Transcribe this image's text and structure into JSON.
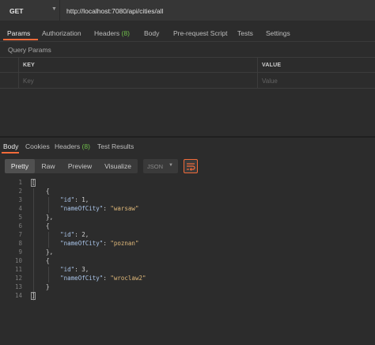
{
  "request": {
    "method": "GET",
    "url": "http://localhost:7080/api/cities/all"
  },
  "request_tabs": [
    {
      "label": "Params",
      "count": ""
    },
    {
      "label": "Authorization",
      "count": ""
    },
    {
      "label": "Headers",
      "count": "(8)"
    },
    {
      "label": "Body",
      "count": ""
    },
    {
      "label": "Pre-request Script",
      "count": ""
    },
    {
      "label": "Tests",
      "count": ""
    },
    {
      "label": "Settings",
      "count": ""
    }
  ],
  "query_params": {
    "title": "Query Params",
    "key_header": "KEY",
    "value_header": "VALUE",
    "key_placeholder": "Key",
    "value_placeholder": "Value"
  },
  "response_tabs": [
    {
      "label": "Body",
      "count": ""
    },
    {
      "label": "Cookies",
      "count": ""
    },
    {
      "label": "Headers",
      "count": "(8)"
    },
    {
      "label": "Test Results",
      "count": ""
    }
  ],
  "view_modes": [
    "Pretty",
    "Raw",
    "Preview",
    "Visualize"
  ],
  "format": "JSON",
  "colors": {
    "accent": "#f26b3a",
    "count": "#6fbf4a",
    "string": "#e0b97a",
    "key": "#a9c4e8"
  },
  "response_body": [
    {
      "n": "1",
      "t": "["
    },
    {
      "n": "2",
      "t": "    {"
    },
    {
      "n": "3",
      "key": "\"id\"",
      "val": "1",
      "vtype": "num",
      "indent": "        "
    },
    {
      "n": "4",
      "key": "\"nameOfCity\"",
      "val": "\"warsaw\"",
      "vtype": "str",
      "indent": "        "
    },
    {
      "n": "5",
      "t": "    },"
    },
    {
      "n": "6",
      "t": "    {"
    },
    {
      "n": "7",
      "key": "\"id\"",
      "val": "2",
      "vtype": "num",
      "indent": "        "
    },
    {
      "n": "8",
      "key": "\"nameOfCity\"",
      "val": "\"poznan\"",
      "vtype": "str",
      "indent": "        "
    },
    {
      "n": "9",
      "t": "    },"
    },
    {
      "n": "10",
      "t": "    {"
    },
    {
      "n": "11",
      "key": "\"id\"",
      "val": "3",
      "vtype": "num",
      "indent": "        "
    },
    {
      "n": "12",
      "key": "\"nameOfCity\"",
      "val": "\"wroclaw2\"",
      "vtype": "str",
      "indent": "        "
    },
    {
      "n": "13",
      "t": "    }"
    },
    {
      "n": "14",
      "t": "]"
    }
  ]
}
